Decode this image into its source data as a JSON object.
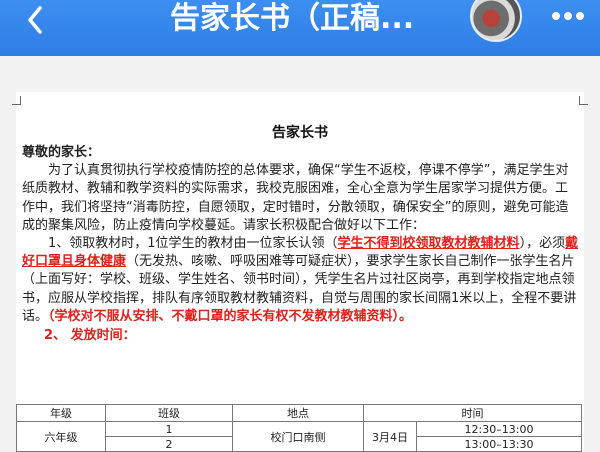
{
  "header": {
    "title": "告家长书（正稿...",
    "back_icon": "back-chevron-icon",
    "more_icon": "more-dots-icon"
  },
  "doc": {
    "title": "告家长书",
    "greeting": "尊敬的家长：",
    "p1": "为了认真贯彻执行学校疫情防控的总体要求，确保“学生不返校，停课不停学”，满足学生对纸质教材、教辅和教学资料的实际需求，我校克服困难，全心全意为学生居家学习提供方便。工作中，我们将坚持“消毒防控，自愿领取，定时错时，分散领取，确保安全”的原则，避免可能造成的聚集风险，防止疫情向学校蔓延。请家长积极配合做好以下工作：",
    "p2_a": "1、领取教材时，1位学生的教材由一位家长认领（",
    "p2_red1": "学生不得到校领取教材教辅材料",
    "p2_b": "），必须",
    "p2_red2": "戴好口罩且身体健康",
    "p2_c": "（无发热、咳嗽、呼吸困难等可疑症状），要求学生家长自己制作一张学生名片（上面写好：学校、班级、学生姓名、领书时间），凭学生名片过社区岗亭，再到学校指定地点领书，应服从学校指挥，排队有序领取教材教辅资料，自觉与周围的家长间隔1米以上，全程不要讲话。",
    "p2_red3": "（学校对不服从安排、不戴口罩的家长有权不发教材教辅资料）。",
    "section2": "2、  发放时间："
  },
  "table": {
    "headers": [
      "年级",
      "班级",
      "地点",
      "时间"
    ],
    "rows": [
      {
        "grade": "",
        "class": "1",
        "place": "校门口南侧",
        "date": "3月4日",
        "time": "12:30–13:00"
      },
      {
        "grade": "六年级",
        "class": "2",
        "place": "",
        "date": "",
        "time": "13:00–13:30"
      }
    ]
  },
  "colors": {
    "header_blue": "#2e7ee6",
    "emphasis_red": "#e0201b"
  }
}
